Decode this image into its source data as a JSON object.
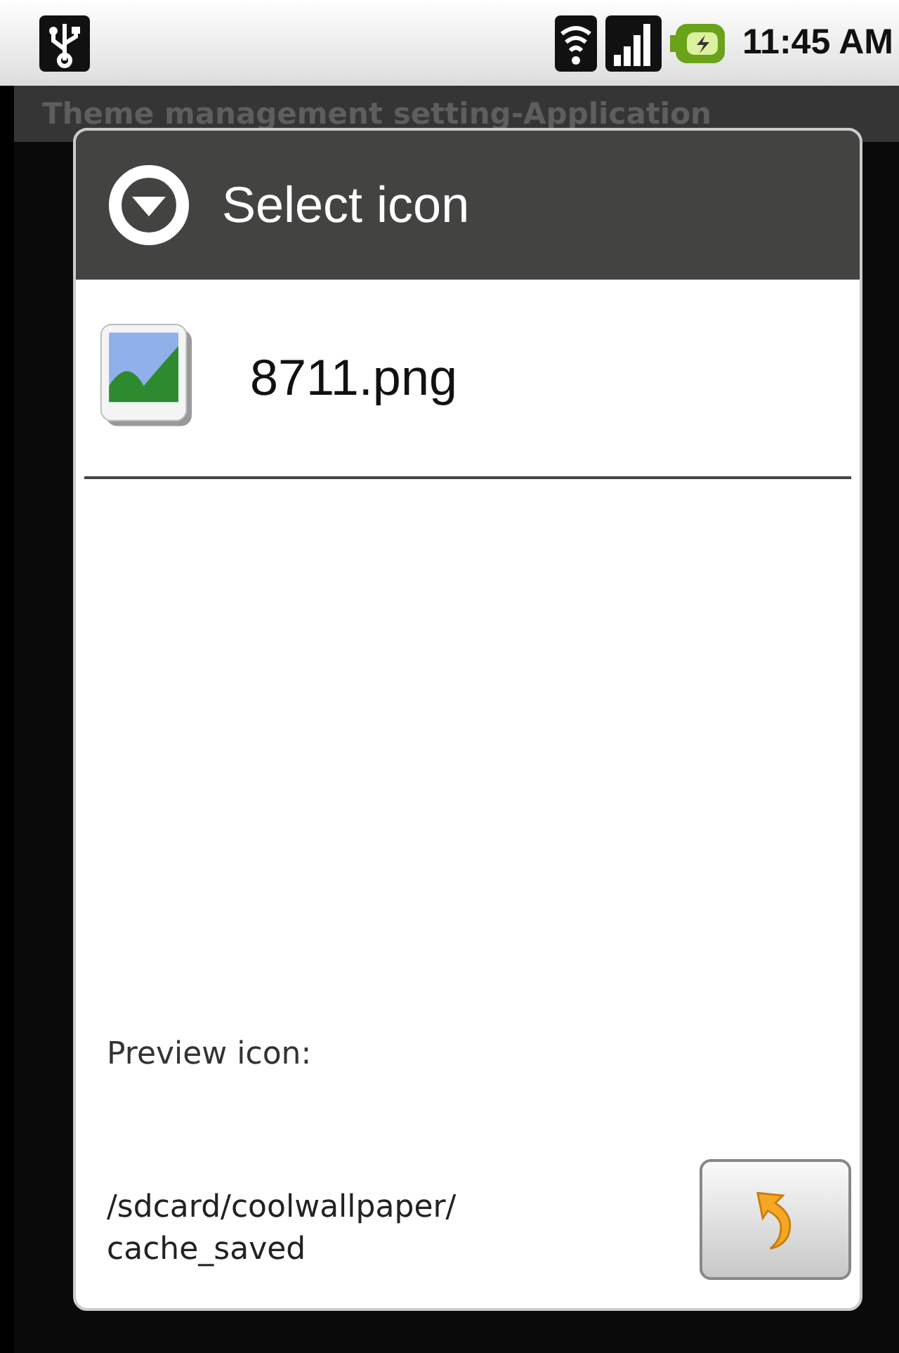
{
  "status_bar": {
    "time": "11:45 AM"
  },
  "app_title": "Theme management setting-Application",
  "dialog": {
    "title": "Select icon",
    "files": [
      {
        "name": "8711.png"
      }
    ],
    "preview_label": "Preview icon:",
    "path_lines": [
      "/sdcard/coolwallpaper/",
      "cache_saved"
    ]
  }
}
